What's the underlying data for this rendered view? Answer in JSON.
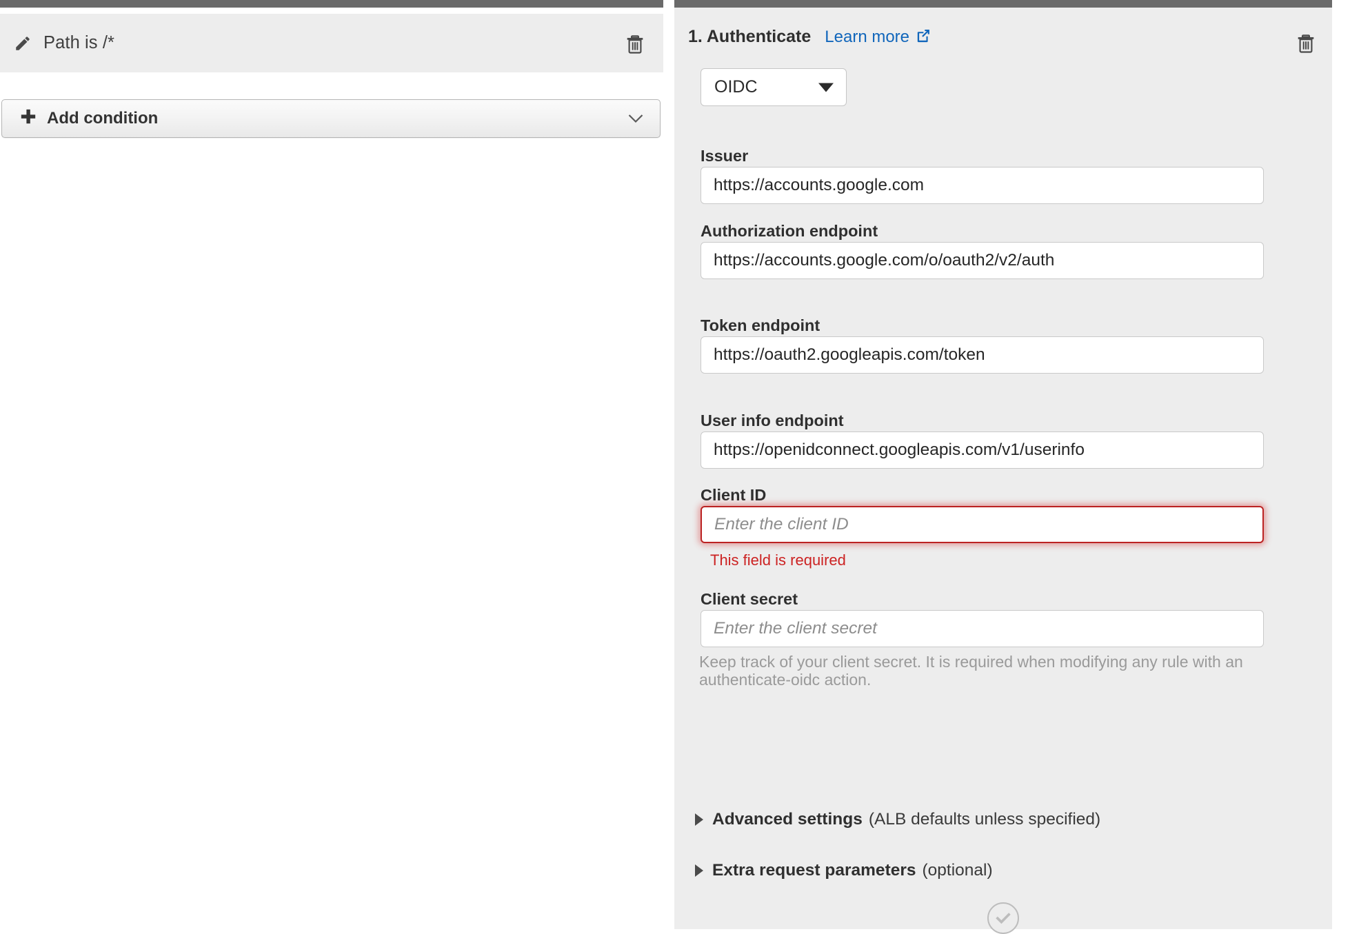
{
  "left_panel": {
    "condition": {
      "icon": "pencil-icon",
      "text": "Path is /*",
      "delete_icon": "trash-icon"
    },
    "add_condition": {
      "plus_icon": "plus-icon",
      "label": "Add condition",
      "chevron_icon": "chevron-down-icon"
    }
  },
  "right_panel": {
    "header": {
      "title": "1. Authenticate",
      "learn_more": "Learn more",
      "external_icon": "external-link-icon",
      "delete_icon": "trash-icon"
    },
    "type_select": {
      "value": "OIDC",
      "caret_icon": "chevron-down-icon",
      "options": [
        "OIDC"
      ]
    },
    "fields": [
      {
        "name": "issuer",
        "label": "Issuer",
        "value": "https://accounts.google.com",
        "placeholder": "",
        "error": "",
        "help": ""
      },
      {
        "name": "authorization-endpoint",
        "label": "Authorization endpoint",
        "value": "https://accounts.google.com/o/oauth2/v2/auth",
        "placeholder": "",
        "error": "",
        "help": ""
      },
      {
        "name": "token-endpoint",
        "label": "Token endpoint",
        "value": "https://oauth2.googleapis.com/token",
        "placeholder": "",
        "error": "",
        "help": ""
      },
      {
        "name": "user-info-endpoint",
        "label": "User info endpoint",
        "value": "https://openidconnect.googleapis.com/v1/userinfo",
        "placeholder": "",
        "error": "",
        "help": ""
      },
      {
        "name": "client-id",
        "label": "Client ID",
        "value": "",
        "placeholder": "Enter the client ID",
        "error": "This field is required",
        "help": ""
      },
      {
        "name": "client-secret",
        "label": "Client secret",
        "value": "",
        "placeholder": "Enter the client secret",
        "error": "",
        "help": "Keep track of your client secret. It is required when modifying any rule with an authenticate-oidc action."
      }
    ],
    "disclosures": [
      {
        "name": "advanced-settings",
        "strong": "Advanced settings",
        "weak": "(ALB defaults unless specified)"
      },
      {
        "name": "extra-request-parameters",
        "strong": "Extra request parameters",
        "weak": "(optional)"
      }
    ],
    "valid_icon": "check-circle-icon"
  },
  "colors": {
    "panel_topbar": "#6a6a6a",
    "panel_background": "#ededed",
    "link": "#1166bb",
    "error": "#cc2222",
    "error_border": "#bb2222",
    "help_text": "#9a9a9a"
  }
}
